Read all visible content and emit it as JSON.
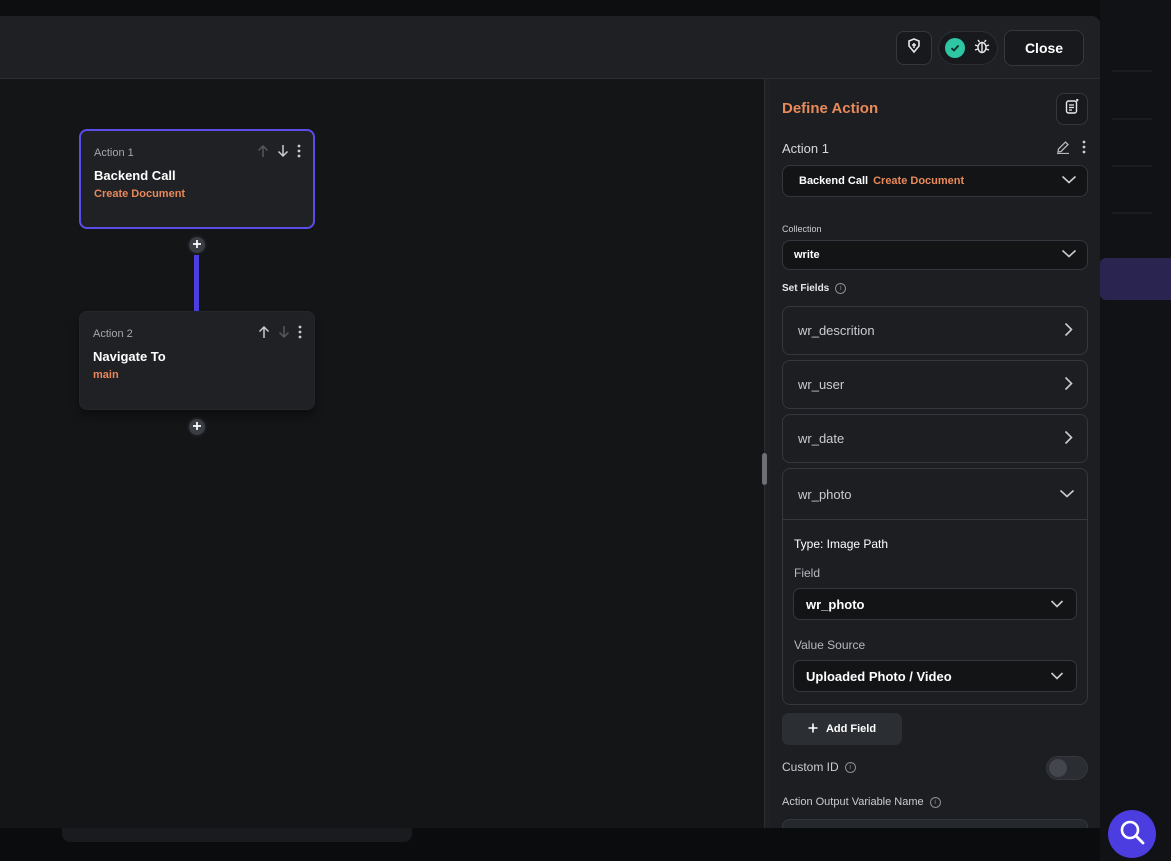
{
  "header": {
    "close_label": "Close"
  },
  "canvas": {
    "nodes": [
      {
        "label": "Action 1",
        "title": "Backend Call",
        "subtitle": "Create Document"
      },
      {
        "label": "Action 2",
        "title": "Navigate To",
        "subtitle": "main"
      }
    ]
  },
  "panel": {
    "title": "Define Action",
    "action_name": "Action 1",
    "action_select": {
      "type": "Backend Call",
      "operation": "Create Document"
    },
    "collection_label": "Collection",
    "collection_value": "write",
    "set_fields_label": "Set Fields",
    "fields": [
      {
        "name": "wr_descrition"
      },
      {
        "name": "wr_user"
      },
      {
        "name": "wr_date"
      },
      {
        "name": "wr_photo"
      }
    ],
    "expanded": {
      "type_text": "Type: Image Path",
      "field_label": "Field",
      "field_value": "wr_photo",
      "value_source_label": "Value Source",
      "value_source_value": "Uploaded Photo / Video"
    },
    "add_field_label": "Add Field",
    "custom_id_label": "Custom ID",
    "output_var_label": "Action Output Variable Name",
    "output_var_value": ""
  },
  "colors": {
    "accent_purple": "#4b3de0",
    "accent_orange": "#e98a5a",
    "success_green": "#2fc6a4"
  },
  "icons": {
    "magic": "magic-wand-icon",
    "check": "check-circle-icon",
    "bug": "bug-icon",
    "doc": "document-icon",
    "edit": "pencil-icon",
    "more": "more-vertical-icon",
    "up": "arrow-up-icon",
    "down": "arrow-down-icon",
    "plus": "plus-icon",
    "chevron_down": "chevron-down-icon",
    "chevron_right": "chevron-right-icon",
    "info": "info-icon",
    "clear": "close-icon",
    "search": "search-icon"
  }
}
